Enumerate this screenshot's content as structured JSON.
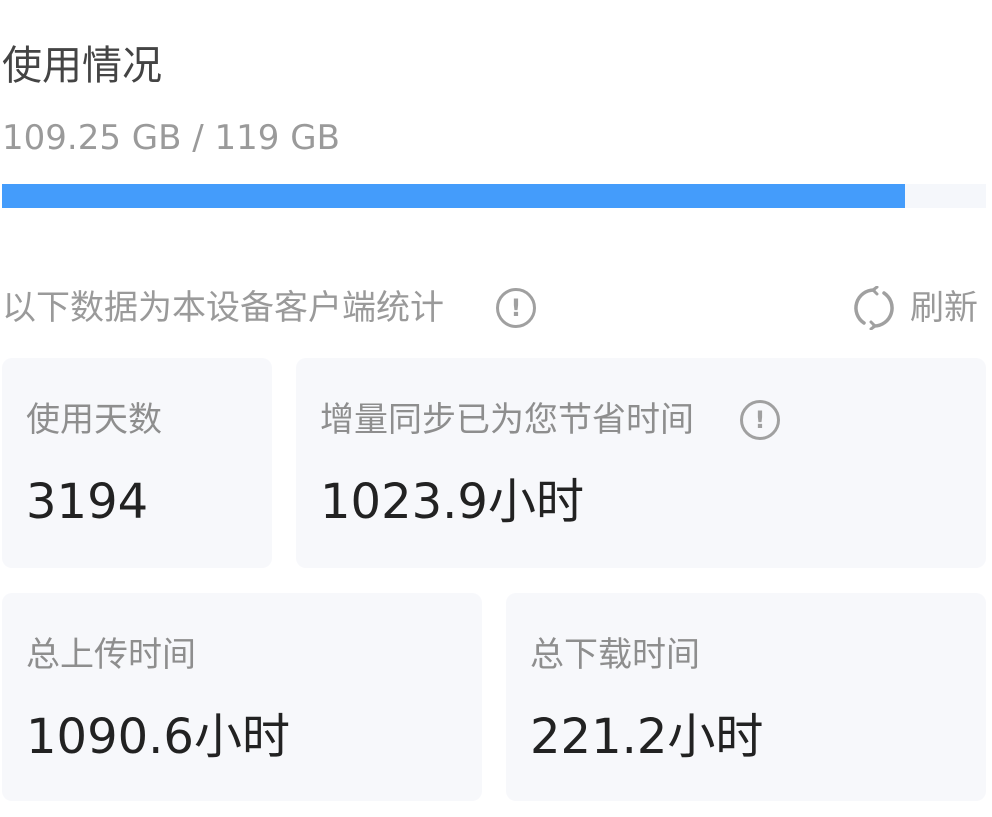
{
  "usage": {
    "title": "使用情况",
    "amount_text": "109.25 GB / 119 GB",
    "used_gb": 109.25,
    "total_gb": 119,
    "progress_fraction": 0.9181,
    "progress_color": "#449cfb"
  },
  "stats_header": {
    "text": "以下数据为本设备客户端统计",
    "info_icon": "info-circle-icon",
    "refresh_icon": "refresh-icon",
    "refresh_label": "刷新"
  },
  "cards": {
    "days_used": {
      "label": "使用天数",
      "value": "3194"
    },
    "time_saved": {
      "label": "增量同步已为您节省时间",
      "value": "1023.9小时",
      "info_icon": "info-circle-icon"
    },
    "upload_time": {
      "label": "总上传时间",
      "value": "1090.6小时"
    },
    "download_time": {
      "label": "总下载时间",
      "value": "221.2小时"
    }
  }
}
